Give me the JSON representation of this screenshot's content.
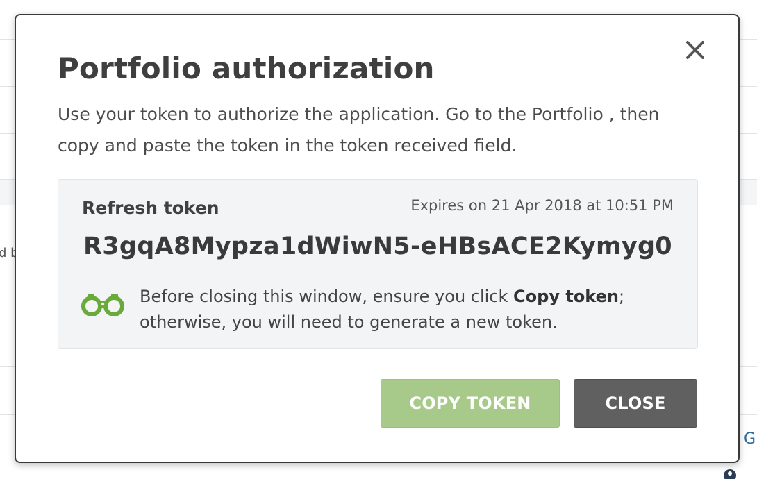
{
  "modal": {
    "title": "Portfolio authorization",
    "description": "Use your token to authorize the application. Go to the Portfolio , then copy and paste the token in the token received field.",
    "close_icon": "close-icon"
  },
  "token_panel": {
    "label": "Refresh token",
    "expiry": "Expires on 21 Apr 2018 at 10:51 PM",
    "value": "R3gqA8Mypza1dWiwN5-eHBsACE2Kymyg0",
    "warning_icon": "binoculars-icon",
    "warning_prefix": "Before closing this window, ensure you click ",
    "warning_bold": "Copy token",
    "warning_suffix": "; otherwise, you will need to generate a new token."
  },
  "buttons": {
    "copy_label": "COPY TOKEN",
    "close_label": "CLOSE"
  },
  "colors": {
    "copy_button": "#a7c98a",
    "close_button": "#606060",
    "icon_green": "#6aaa3a",
    "panel_background": "#f3f4f5"
  },
  "background": {
    "left_fragment": "d b",
    "right_fragment": "G",
    "bottom_text": "..."
  }
}
